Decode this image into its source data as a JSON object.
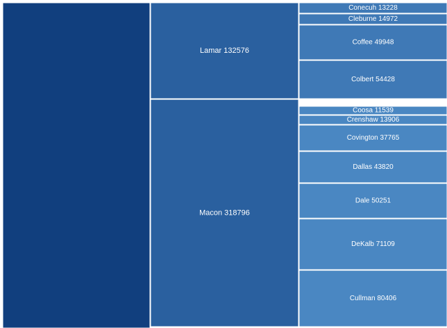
{
  "chart_data": {
    "type": "treemap",
    "colors": {
      "depth0": "#113f7e",
      "depth1": "#2a609f",
      "depth2": "#3f79b6",
      "depth2_light": "#4a87c2",
      "border": "#ffffff",
      "label": "#ffffff"
    },
    "nodes": [
      {
        "id": "root",
        "name": "",
        "value": 0
      },
      {
        "id": "lamar",
        "name": "Lamar",
        "value": 132576
      },
      {
        "id": "macon",
        "name": "Macon",
        "value": 318796
      },
      {
        "id": "conecuh",
        "name": "Conecuh",
        "value": 13228
      },
      {
        "id": "cleburne",
        "name": "Cleburne",
        "value": 14972
      },
      {
        "id": "coffee",
        "name": "Coffee",
        "value": 49948
      },
      {
        "id": "colbert",
        "name": "Colbert",
        "value": 54428
      },
      {
        "id": "coosa",
        "name": "Coosa",
        "value": 11539
      },
      {
        "id": "crenshaw",
        "name": "Crenshaw",
        "value": 13906
      },
      {
        "id": "covington",
        "name": "Covington",
        "value": 37765
      },
      {
        "id": "dallas",
        "name": "Dallas",
        "value": 43820
      },
      {
        "id": "dale",
        "name": "Dale",
        "value": 50251
      },
      {
        "id": "dekalb",
        "name": "DeKalb",
        "value": 71109
      },
      {
        "id": "cullman",
        "name": "Cullman",
        "value": 80406
      }
    ]
  }
}
